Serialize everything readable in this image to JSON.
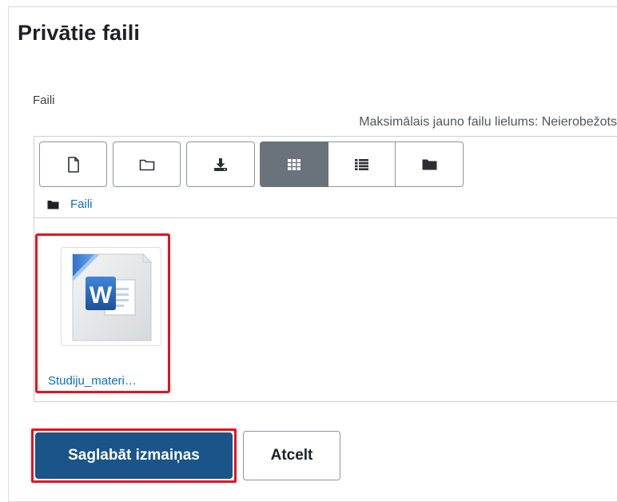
{
  "page": {
    "title": "Privātie faili"
  },
  "filemanager": {
    "label": "Faili",
    "max_size_text": "Maksimālais jauno failu lielums: Neierobežots",
    "toolbar": {
      "icons": [
        "file-icon",
        "folder-icon",
        "download-icon",
        "grid-view-icon",
        "list-view-icon",
        "tree-view-icon"
      ],
      "active_view": "grid-view"
    },
    "breadcrumb": {
      "label": "Faili"
    },
    "files": [
      {
        "name": "Studiju_materi…",
        "icon": "word-document-icon"
      }
    ]
  },
  "actions": {
    "save_label": "Saglabāt izmaiņas",
    "cancel_label": "Atcelt"
  },
  "colors": {
    "primary": "#1a5489",
    "link": "#0f6cbf",
    "highlight": "#e8101e",
    "active_toggle": "#6a737b"
  }
}
